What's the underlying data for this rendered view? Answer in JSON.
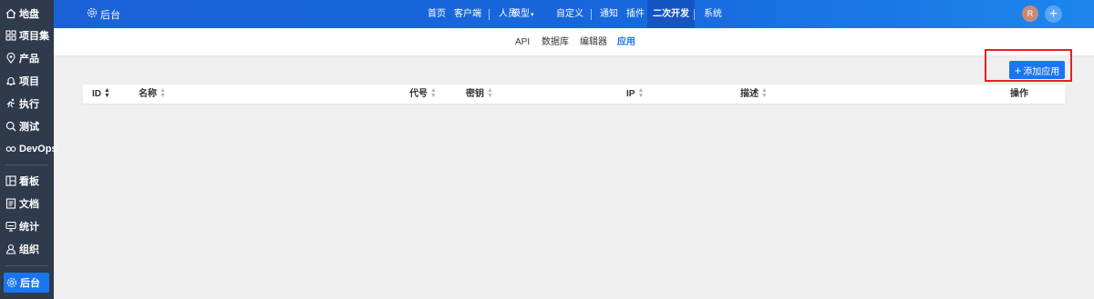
{
  "sidebar": {
    "items": [
      {
        "label": "地盘",
        "icon": "home-icon"
      },
      {
        "label": "项目集",
        "icon": "grid-icon"
      },
      {
        "label": "产品",
        "icon": "location-icon"
      },
      {
        "label": "项目",
        "icon": "bell-icon"
      },
      {
        "label": "执行",
        "icon": "run-icon"
      },
      {
        "label": "测试",
        "icon": "search-icon"
      },
      {
        "label": "DevOps",
        "icon": "infinity-icon"
      },
      {
        "label": "看板",
        "icon": "board-icon"
      },
      {
        "label": "文档",
        "icon": "doc-icon"
      },
      {
        "label": "统计",
        "icon": "monitor-icon"
      },
      {
        "label": "组织",
        "icon": "user-icon"
      },
      {
        "label": "后台",
        "icon": "gear-icon",
        "active": true
      }
    ]
  },
  "topbar": {
    "title": "后台",
    "nav": [
      {
        "label": "首页"
      },
      {
        "label": "客户端"
      },
      {
        "label": "人员"
      },
      {
        "label": "模型"
      },
      {
        "label": "自定义"
      },
      {
        "label": "通知"
      },
      {
        "label": "插件"
      },
      {
        "label": "二次开发",
        "active": true
      },
      {
        "label": "系统"
      }
    ],
    "avatar_letter": "R",
    "plus": "+"
  },
  "subnav": {
    "items": [
      {
        "label": "API"
      },
      {
        "label": "数据库"
      },
      {
        "label": "编辑器"
      },
      {
        "label": "应用",
        "active": true
      }
    ]
  },
  "toolbar": {
    "add_label": "添加应用",
    "add_plus": "+"
  },
  "table": {
    "columns": [
      {
        "label": "ID",
        "sorted": true
      },
      {
        "label": "名称"
      },
      {
        "label": "代号"
      },
      {
        "label": "密钥"
      },
      {
        "label": "IP"
      },
      {
        "label": "描述"
      },
      {
        "label": "操作",
        "sortable": false
      }
    ]
  },
  "colors": {
    "accent": "#1976f0",
    "sidebar": "#2f3a4c",
    "highlight": "#e8201e"
  }
}
